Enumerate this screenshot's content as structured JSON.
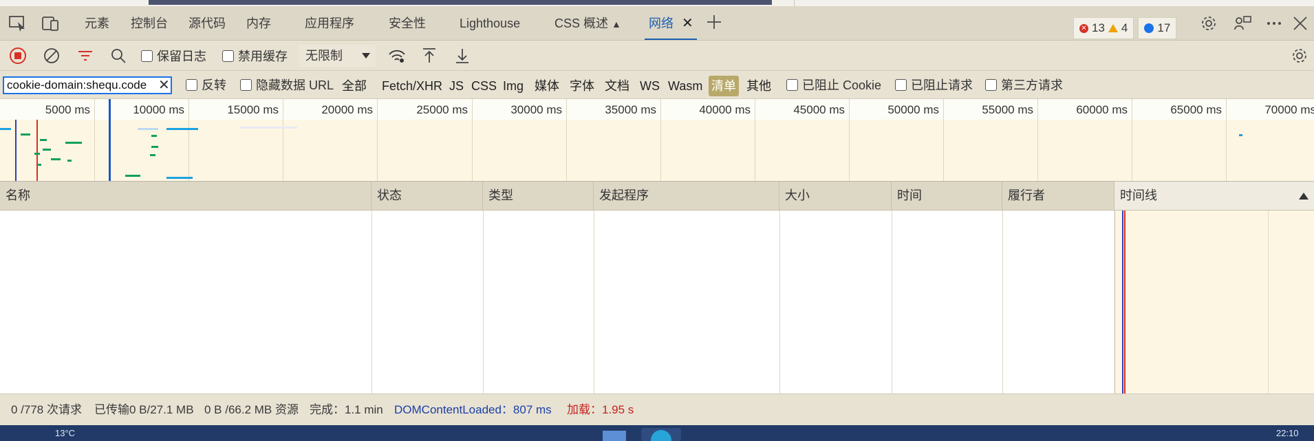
{
  "tabs": [
    {
      "label": "元素"
    },
    {
      "label": "控制台"
    },
    {
      "label": "源代码"
    },
    {
      "label": "内存"
    },
    {
      "label": "应用程序"
    },
    {
      "label": "安全性"
    },
    {
      "label": "Lighthouse"
    },
    {
      "label": "CSS 概述"
    },
    {
      "label": "网络"
    }
  ],
  "badges": {
    "errors": "13",
    "warnings": "4",
    "messages": "17"
  },
  "toolbar": {
    "preserve_log": "保留日志",
    "disable_cache": "禁用缓存",
    "throttling": "无限制"
  },
  "filter": {
    "value": "cookie-domain:shequ.code",
    "invert": "反转",
    "hide_data_url": "隐藏数据 URL",
    "types": [
      "全部",
      "Fetch/XHR",
      "JS",
      "CSS",
      "Img",
      "媒体",
      "字体",
      "文档",
      "WS",
      "Wasm",
      "清单",
      "其他"
    ],
    "selected_type": "清单",
    "blocked_cookies": "已阻止 Cookie",
    "blocked_requests": "已阻止请求",
    "third_party": "第三方请求"
  },
  "overview": {
    "ticks": [
      "5000 ms",
      "10000 ms",
      "15000 ms",
      "20000 ms",
      "25000 ms",
      "30000 ms",
      "35000 ms",
      "40000 ms",
      "45000 ms",
      "50000 ms",
      "55000 ms",
      "60000 ms",
      "65000 ms",
      "70000 ms"
    ]
  },
  "columns": [
    "名称",
    "状态",
    "类型",
    "发起程序",
    "大小",
    "时间",
    "履行者",
    "时间线"
  ],
  "status": {
    "requests": "0 /778 次请求",
    "transferred": "已传输0 B/27.1 MB",
    "resources": "0 B /66.2 MB 资源",
    "finish": "完成：1.1 min",
    "dcl": "DOMContentLoaded：807 ms",
    "load": "加载：1.95 s"
  },
  "taskbar": {
    "temp": "13°C",
    "clock": "22:10"
  },
  "colors": {
    "accent": "#1a73e8",
    "active_tab": "#1b5fb0",
    "selected_filter": "#b8a96a",
    "dcl": "#1a3fa8",
    "load": "#c5221f"
  }
}
